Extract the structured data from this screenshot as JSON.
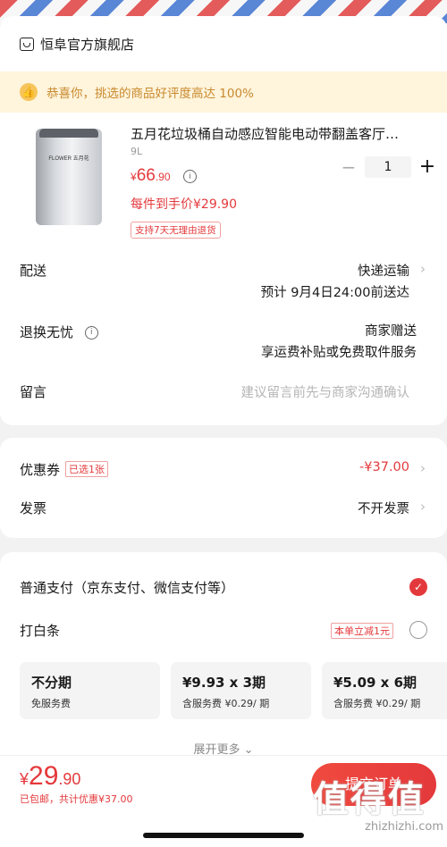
{
  "store": {
    "name": "恒阜官方旗舰店",
    "icon": "store-icon"
  },
  "banner": {
    "text": "恭喜你，挑选的商品好评度高达 100%",
    "icon": "thumbs-up-icon"
  },
  "product": {
    "title": "五月花垃圾桶自动感应智能电动带翻盖客厅…",
    "spec": "9L",
    "logo_text": "FLOWER 五月花",
    "price_currency": "¥",
    "price_int": "66",
    "price_dec": ".90",
    "unit_price": "每件到手价¥29.90",
    "return_tag": "支持7天无理由退货",
    "quantity": "1",
    "minus": "−",
    "plus": "+"
  },
  "delivery": {
    "label": "配送",
    "method": "快递运输",
    "eta": "预计 9月4日24:00前送达"
  },
  "returns": {
    "label": "退换无忧",
    "line1": "商家赠送",
    "line2": "享运费补贴或免费取件服务"
  },
  "message": {
    "label": "留言",
    "placeholder": "建议留言前先与商家沟通确认"
  },
  "coupon": {
    "label": "优惠券",
    "badge": "已选1张",
    "value": "-¥37.00"
  },
  "invoice": {
    "label": "发票",
    "value": "不开发票"
  },
  "payment": {
    "normal": "普通支付（京东支付、微信支付等）",
    "baitiao": "打白条",
    "baitiao_promo": "本单立减1元",
    "plans": [
      {
        "title": "不分期",
        "sub": "免服务费"
      },
      {
        "title": "¥9.93 x 3期",
        "sub": "含服务费 ¥0.29/ 期"
      },
      {
        "title": "¥5.09 x 6期",
        "sub": "含服务费 ¥0.29/ 期"
      }
    ],
    "expand": "展开更多"
  },
  "footer": {
    "currency": "¥",
    "total_int": "29",
    "total_dec": ".90",
    "saved": "已包邮，共计优惠¥37.00",
    "submit": "提交订单"
  },
  "watermark": {
    "glyphs": "值得值",
    "url": "zhizhizhi.com"
  },
  "colors": {
    "accent": "#e4393c",
    "banner_bg": "#fff4dc",
    "banner_text": "#c88a2e"
  }
}
